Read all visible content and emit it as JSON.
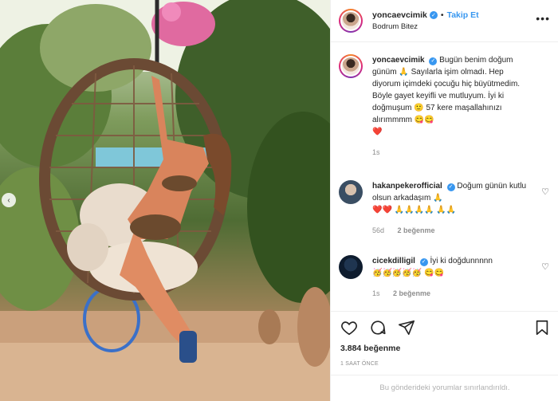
{
  "post": {
    "username": "yoncaevcimik",
    "follow_label": "Takip Et",
    "dot": "•",
    "location": "Bodrum Bitez",
    "more_label": "•••",
    "prev_arrow": "‹"
  },
  "caption": {
    "username": "yoncaevcimik",
    "text_part1": "Bugün benim doğum günüm",
    "emoji1": "🙏",
    "text_part2": "Sayılarla işim olmadı. Hep diyorum içimdeki çocuğu hiç büyütmedim. Böyle gayet keyifli ve mutluyum. İyi ki doğmuşum",
    "emoji2": "🙂",
    "text_part3": "57 kere maşallahınızı alırımmmm",
    "emoji3": "😋😋",
    "emoji4": "❤️",
    "age": "1s"
  },
  "comments": [
    {
      "username": "hakanpekerofficial",
      "text": "Doğum günün kutlu olsun arkadaşım",
      "emoji_a": "🙏",
      "emoji_b": "❤️❤️",
      "emoji_c": "🙏🙏🙏🙏",
      "emoji_d": "🙏🙏",
      "age": "56d",
      "likes": "2 beğenme",
      "heart": "♡"
    },
    {
      "username": "cicekdilligil",
      "text": "İyi ki doğdunnnnn",
      "emoji_a": "🥳🥳🥳🥳🥳",
      "emoji_b": "😋😋",
      "age": "1s",
      "likes": "2 beğenme",
      "heart": "♡"
    }
  ],
  "footer": {
    "likes_total": "3.884 beğenme",
    "time_ago": "1 SAAT ÖNCE",
    "comments_limited": "Bu gönderideki yorumlar sınırlandırıldı."
  },
  "icons": {
    "like": "heart-icon",
    "comment": "comment-icon",
    "share": "send-icon",
    "save": "bookmark-icon"
  },
  "colors": {
    "link_blue": "#3897f0",
    "meta_gray": "#8e8e8e"
  }
}
